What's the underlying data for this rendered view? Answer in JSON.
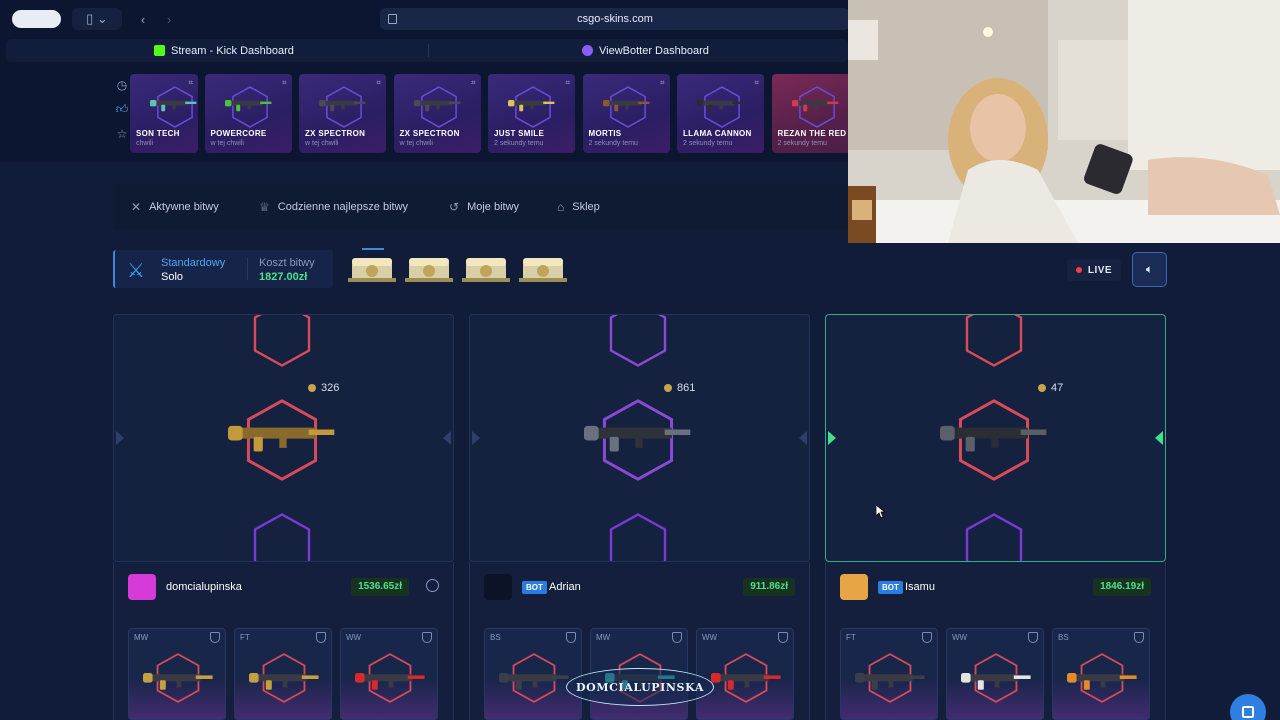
{
  "browser": {
    "url": "csgo-skins.com",
    "tabs": [
      {
        "label": "Stream - Kick Dashboard",
        "favicon_color": "#53fc18"
      },
      {
        "label": "ViewBotter Dashboard",
        "favicon_color": "#8b5cf6"
      }
    ]
  },
  "drops": [
    {
      "name": "SON TECH",
      "time": "chwili",
      "tone": "purple"
    },
    {
      "name": "POWERCORE",
      "time": "w tej chwili",
      "tone": "purple"
    },
    {
      "name": "ZX SPECTRON",
      "time": "w tej chwili",
      "tone": "purple"
    },
    {
      "name": "ZX SPECTRON",
      "time": "w tej chwili",
      "tone": "purple"
    },
    {
      "name": "JUST SMILE",
      "time": "2 sekundy temu",
      "tone": "purple"
    },
    {
      "name": "MORTIS",
      "time": "2 sekundy temu",
      "tone": "purple"
    },
    {
      "name": "LLAMA CANNON",
      "time": "2 sekundy temu",
      "tone": "purple"
    },
    {
      "name": "REZAN THE RED",
      "time": "2 sekundy temu",
      "tone": "red"
    }
  ],
  "nav": [
    {
      "label": "Aktywne bitwy",
      "icon": "swords-icon"
    },
    {
      "label": "Codzienne najlepsze bitwy",
      "icon": "trophy-icon"
    },
    {
      "label": "Moje bitwy",
      "icon": "history-icon"
    },
    {
      "label": "Sklep",
      "icon": "basket-icon"
    }
  ],
  "battle": {
    "mode_label": "Standardowy",
    "mode_value": "Solo",
    "cost_label": "Koszt bitwy",
    "cost_value": "1827.00zł",
    "cases_count": 4,
    "live_label": "LIVE"
  },
  "players": [
    {
      "name": "domcialupinska",
      "bot": false,
      "amount": "1536.65zł",
      "coins": "326",
      "active": false,
      "avatar_color": "#d63ad9",
      "items": [
        {
          "wear": "MW"
        },
        {
          "wear": "FT"
        },
        {
          "wear": "WW"
        }
      ]
    },
    {
      "name": "Adrian",
      "bot": true,
      "bot_label": "BOT",
      "amount": "911.86zł",
      "coins": "861",
      "active": false,
      "avatar_color": "#0b1426",
      "items": [
        {
          "wear": "BS"
        },
        {
          "wear": "MW"
        },
        {
          "wear": "WW"
        }
      ]
    },
    {
      "name": "Isamu",
      "bot": true,
      "bot_label": "BOT",
      "amount": "1846.19zł",
      "coins": "47",
      "active": true,
      "avatar_color": "#e7a545",
      "items": [
        {
          "wear": "FT"
        },
        {
          "wear": "WW"
        },
        {
          "wear": "BS"
        }
      ]
    }
  ],
  "overlay_logo": "DOMCIALUPINSKA",
  "colors": {
    "accent": "#3d8bd6",
    "money": "#4fe08a",
    "active_border": "#2fae8c",
    "live_dot": "#ff3b4a"
  }
}
